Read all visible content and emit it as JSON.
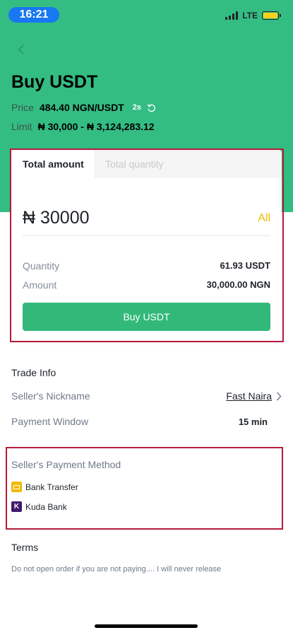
{
  "status_bar": {
    "time": "16:21",
    "network": "LTE"
  },
  "header": {
    "title": "Buy USDT",
    "price_label": "Price",
    "price_value": "484.40 NGN/USDT",
    "timer": "2s",
    "limit_label": "Limit",
    "limit_value": "₦ 30,000 - ₦ 3,124,283.12"
  },
  "order_card": {
    "tabs": [
      {
        "label": "Total amount",
        "active": true
      },
      {
        "label": "Total quantity",
        "active": false
      }
    ],
    "amount_input": "₦ 30000",
    "all_label": "All",
    "quantity_label": "Quantity",
    "quantity_value": "61.93 USDT",
    "amount_label": "Amount",
    "amount_value": "30,000.00 NGN",
    "buy_button": "Buy USDT"
  },
  "trade_info": {
    "title": "Trade Info",
    "nickname_label": "Seller's Nickname",
    "nickname_value": "Fast Naira",
    "payment_window_label": "Payment Window",
    "payment_window_value": "15 min"
  },
  "payment_methods": {
    "title": "Seller's Payment Method",
    "items": [
      {
        "label": "Bank Transfer",
        "icon": "bank-transfer-icon"
      },
      {
        "label": "Kuda Bank",
        "icon": "kuda-bank-icon"
      }
    ]
  },
  "terms": {
    "title": "Terms",
    "text": "Do not open order if you are not paying.... I will never release"
  },
  "colors": {
    "header_green": "#34bd83",
    "buy_button": "#32b97a",
    "accent_yellow": "#f0b90b",
    "highlight_red": "#b71c3c",
    "time_pill": "#1877f2"
  }
}
